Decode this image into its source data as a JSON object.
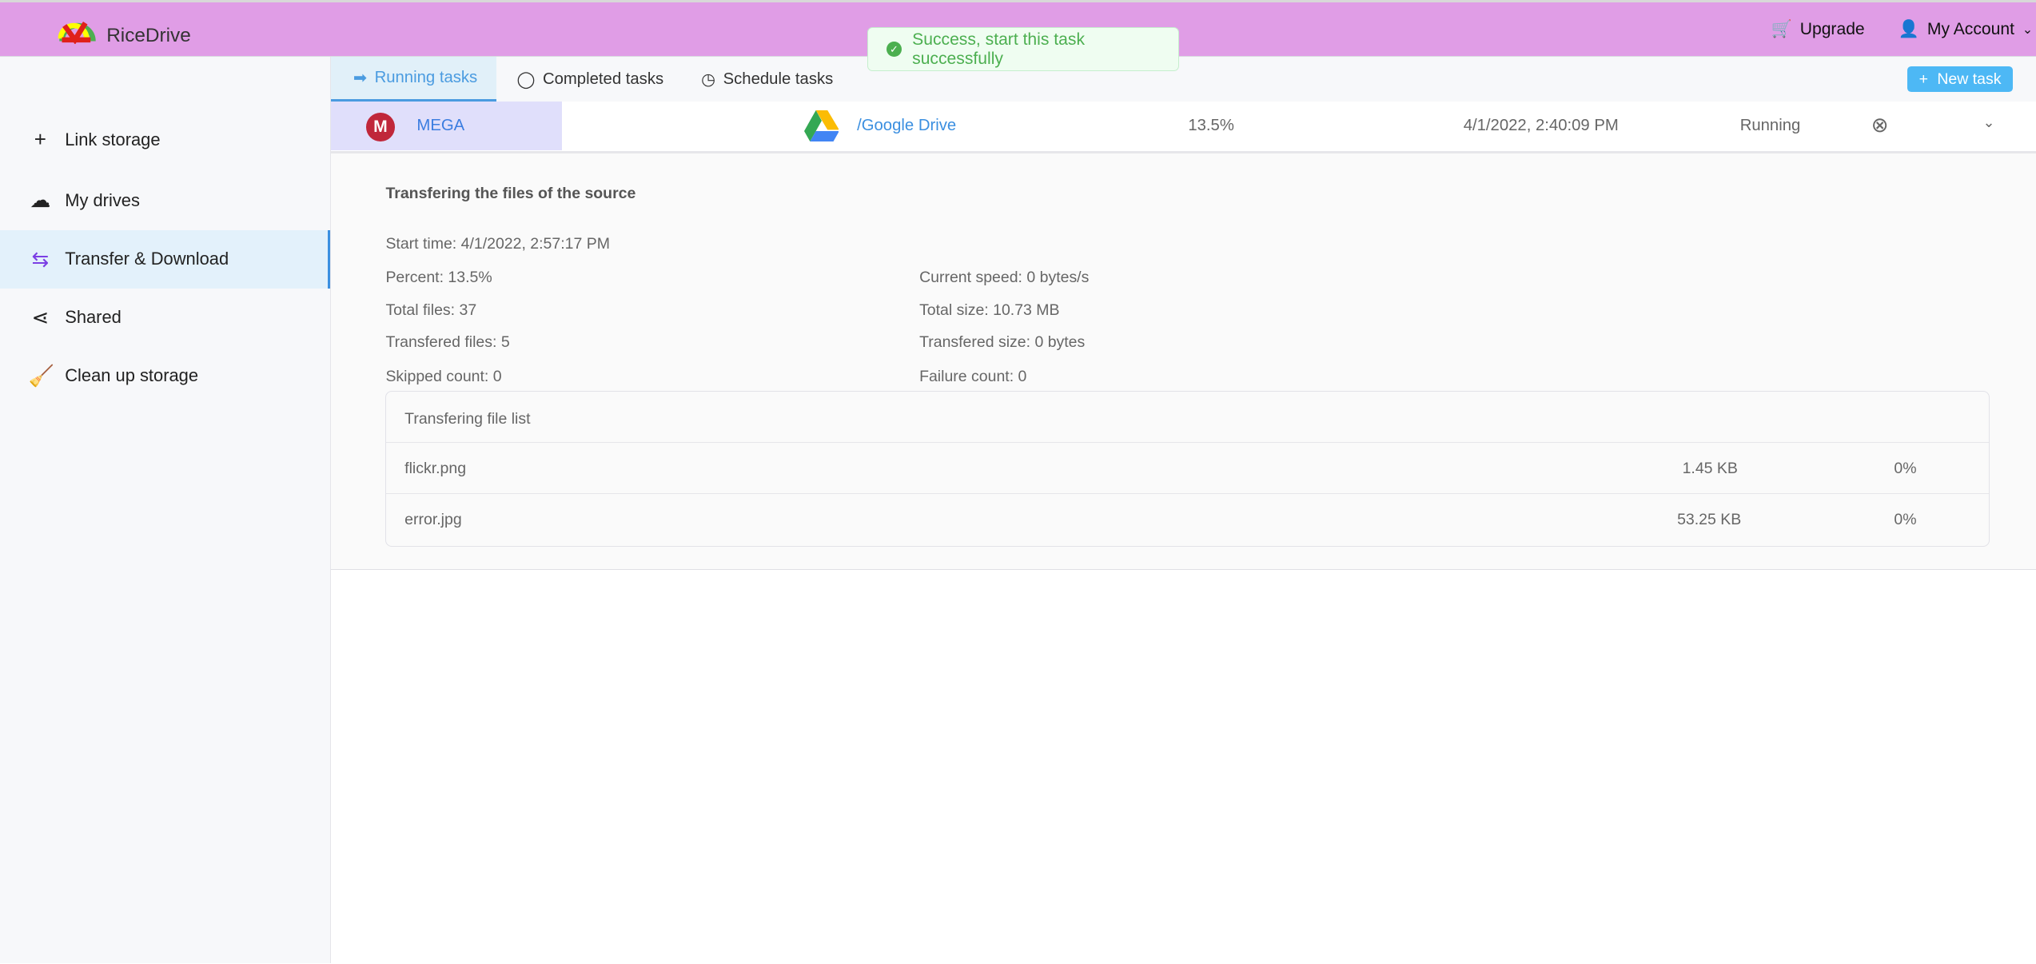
{
  "header": {
    "brand": "RiceDrive",
    "upgrade": "Upgrade",
    "account": "My Account",
    "color": "#e09de6"
  },
  "toast": {
    "message": "Success, start this task successfully"
  },
  "sidebar": {
    "items": [
      {
        "label": "Link storage",
        "icon": "plus-icon"
      },
      {
        "label": "My drives",
        "icon": "cloud-icon"
      },
      {
        "label": "Transfer & Download",
        "icon": "transfer-icon",
        "active": true
      },
      {
        "label": "Shared",
        "icon": "share-icon"
      },
      {
        "label": "Clean up storage",
        "icon": "broom-icon"
      }
    ]
  },
  "tabs": [
    {
      "label": "Running tasks",
      "active": true
    },
    {
      "label": "Completed tasks"
    },
    {
      "label": "Schedule tasks"
    }
  ],
  "new_task": "New task",
  "task": {
    "source": "MEGA",
    "destination": "/Google Drive",
    "percent": "13.5%",
    "time": "4/1/2022, 2:40:09 PM",
    "status": "Running"
  },
  "detail": {
    "title": "Transfering the files of the source",
    "start_time": "Start time: 4/1/2022, 2:57:17 PM",
    "percent": "Percent: 13.5%",
    "speed": "Current speed: 0 bytes/s",
    "total_files": "Total files: 37",
    "total_size": "Total size: 10.73 MB",
    "transfered_files": "Transfered files: 5",
    "transfered_size": "Transfered size: 0 bytes",
    "skipped": "Skipped count: 0",
    "failure": "Failure count: 0",
    "file_list": {
      "title": "Transfering file list",
      "files": [
        {
          "name": "flickr.png",
          "size": "1.45 KB",
          "progress": "0%"
        },
        {
          "name": "error.jpg",
          "size": "53.25 KB",
          "progress": "0%"
        }
      ]
    }
  }
}
